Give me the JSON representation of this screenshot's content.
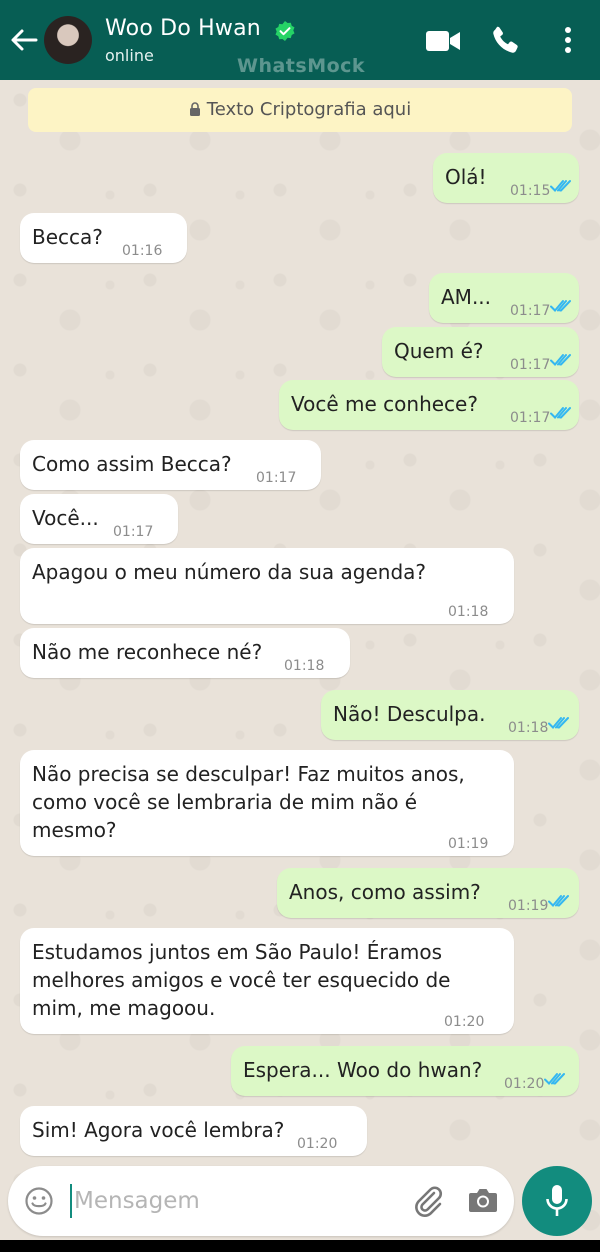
{
  "header": {
    "contact_name": "Woo Do Hwan",
    "status": "online",
    "watermark": "WhatsMock"
  },
  "encryption_notice": "Texto Criptografia aqui",
  "messages": [
    {
      "side": "out",
      "text": "Olá!",
      "time": "01:15",
      "read": true
    },
    {
      "side": "in",
      "text": "Becca?",
      "time": "01:16"
    },
    {
      "side": "out",
      "text": "AM...",
      "time": "01:17",
      "read": true
    },
    {
      "side": "out",
      "text": "Quem é?",
      "time": "01:17",
      "read": true
    },
    {
      "side": "out",
      "text": "Você me conhece?",
      "time": "01:17",
      "read": true
    },
    {
      "side": "in",
      "text": "Como assim Becca?",
      "time": "01:17"
    },
    {
      "side": "in",
      "text": "Você...",
      "time": "01:17"
    },
    {
      "side": "in",
      "text": "Apagou o meu número da sua agenda?",
      "time": "01:18"
    },
    {
      "side": "in",
      "text": "Não me reconhece né?",
      "time": "01:18"
    },
    {
      "side": "out",
      "text": "Não! Desculpa.",
      "time": "01:18",
      "read": true
    },
    {
      "side": "in",
      "text": "Não precisa se desculpar! Faz muitos anos,\ncomo você se lembraria de mim não é\nmesmo?",
      "time": "01:19"
    },
    {
      "side": "out",
      "text": "Anos, como assim?",
      "time": "01:19",
      "read": true
    },
    {
      "side": "in",
      "text": "Estudamos juntos em São Paulo! Éramos\nmelhores amigos e você ter esquecido de\nmim, me magoou.",
      "time": "01:20"
    },
    {
      "side": "out",
      "text": "Espera... Woo do hwan?",
      "time": "01:20",
      "read": true
    },
    {
      "side": "in",
      "text": "Sim! Agora você lembra?",
      "time": "01:20"
    }
  ],
  "input": {
    "placeholder": "Mensagem",
    "value": ""
  },
  "colors": {
    "header": "#075e54",
    "outgoing_bubble": "#dcf8c6",
    "incoming_bubble": "#ffffff",
    "read_ticks": "#34b7f1",
    "mic_button": "#128c7e"
  }
}
